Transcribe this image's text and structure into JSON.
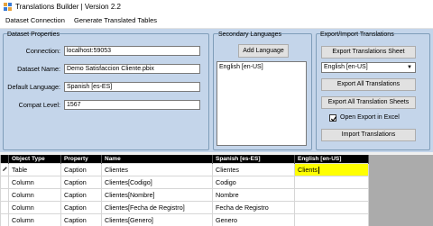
{
  "window": {
    "title": "Translations Builder | Version 2.2"
  },
  "menu": [
    {
      "label": "Dataset Connection"
    },
    {
      "label": "Generate Translated Tables"
    }
  ],
  "dataset_properties": {
    "title": "Dataset Properties",
    "fields": [
      {
        "label": "Connection:",
        "value": "localhost:59053"
      },
      {
        "label": "Dataset Name:",
        "value": "Demo Satisfaccion Cliente.pbix"
      },
      {
        "label": "Default Language:",
        "value": "Spanish [es-ES]"
      },
      {
        "label": "Compat Level:",
        "value": "1567"
      }
    ]
  },
  "secondary_languages": {
    "title": "Secondary Languages",
    "add_button": "Add Language",
    "items": [
      "English [en-US]"
    ]
  },
  "export_import": {
    "title": "Export/Import Translations",
    "export_sheet_button": "Export Translations Sheet",
    "language_select": "English [en-US]",
    "export_all_button": "Export All Translations",
    "export_all_sheets_button": "Export All Translation Sheets",
    "open_in_excel_label": "Open Export in Excel",
    "open_in_excel_checked": true,
    "import_button": "Import Translations"
  },
  "grid": {
    "columns": [
      "Object Type",
      "Property",
      "Name",
      "Spanish [es-ES]",
      "English [en-US]"
    ],
    "rows": [
      {
        "object_type": "Table",
        "property": "Caption",
        "name": "Clientes",
        "spanish": "Clientes",
        "english": "Clients",
        "editing": true
      },
      {
        "object_type": "Column",
        "property": "Caption",
        "name": "Clientes[Codigo]",
        "spanish": "Codigo",
        "english": ""
      },
      {
        "object_type": "Column",
        "property": "Caption",
        "name": "Clientes[Nombre]",
        "spanish": "Nombre",
        "english": ""
      },
      {
        "object_type": "Column",
        "property": "Caption",
        "name": "Clientes[Fecha de Registro]",
        "spanish": "Fecha de Registro",
        "english": ""
      },
      {
        "object_type": "Column",
        "property": "Caption",
        "name": "Clientes[Genero]",
        "spanish": "Genero",
        "english": ""
      }
    ]
  },
  "colors": {
    "panel_bg": "#c4d5ea",
    "grid_header_bg": "#000000",
    "edit_cell_bg": "#ffff00"
  }
}
